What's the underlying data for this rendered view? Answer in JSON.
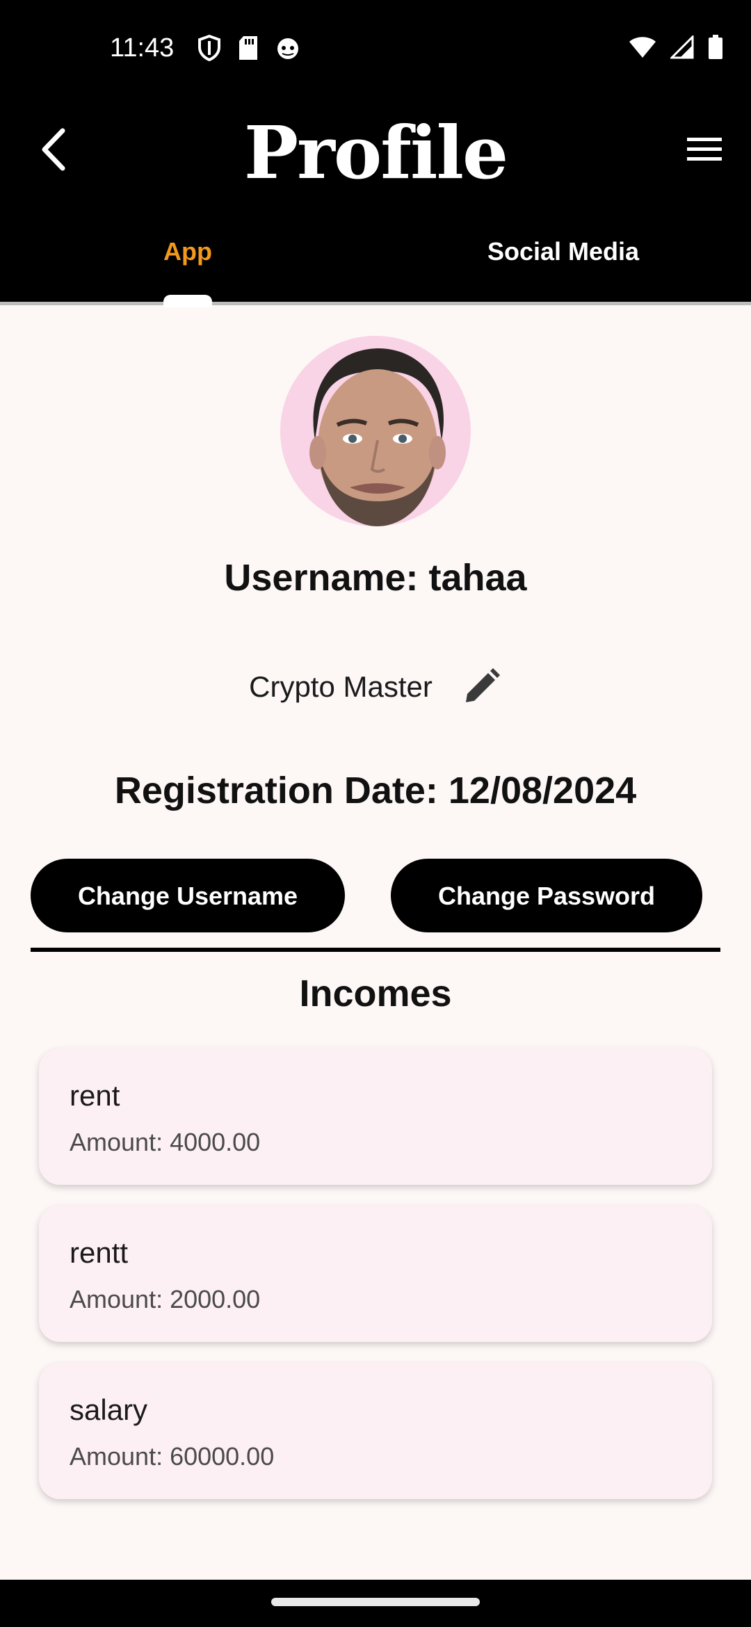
{
  "status_bar": {
    "time": "11:43",
    "left_icons": [
      "shield-icon",
      "sd-card-icon",
      "cat-face-icon"
    ],
    "right_icons": [
      "wifi-icon",
      "signal-icon",
      "battery-icon"
    ]
  },
  "app_bar": {
    "title": "Profile",
    "back_icon": "chevron-left-icon",
    "menu_icon": "hamburger-menu-icon"
  },
  "tabs": [
    {
      "label": "App",
      "selected": true
    },
    {
      "label": "Social Media",
      "selected": false
    }
  ],
  "colors": {
    "tab_active": "#f29a1c",
    "background": "#fdf7f6",
    "card": "#fdf0f4",
    "avatar_ring": "#f9d3e6"
  },
  "profile": {
    "username_line": "Username: tahaa",
    "user_title": "Crypto Master",
    "registration_line": "Registration Date: 12/08/2024"
  },
  "actions": {
    "change_username": "Change Username",
    "change_password": "Change Password"
  },
  "incomes": {
    "title": "Incomes",
    "items": [
      {
        "name": "rent",
        "amount": "Amount: 4000.00"
      },
      {
        "name": "rentt",
        "amount": "Amount: 2000.00"
      },
      {
        "name": "salary",
        "amount": "Amount: 60000.00"
      }
    ]
  }
}
